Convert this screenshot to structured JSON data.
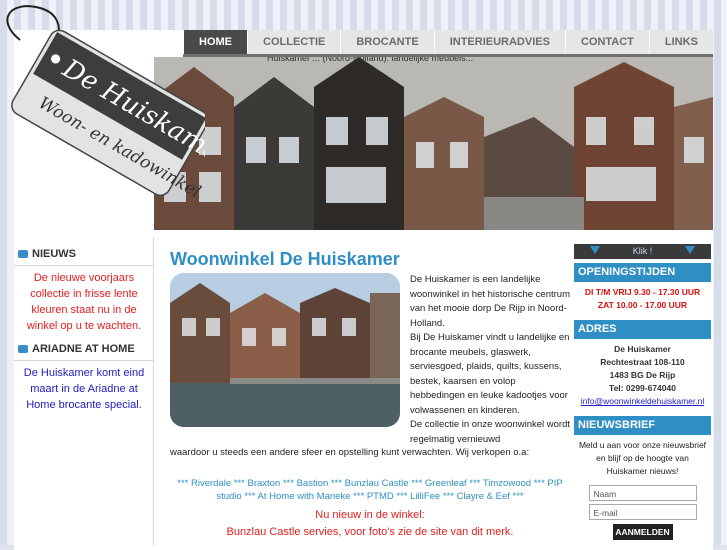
{
  "nav": {
    "items": [
      "HOME",
      "COLLECTIE",
      "BROCANTE",
      "INTERIEURADVIES",
      "CONTACT",
      "LINKS"
    ],
    "active": 0
  },
  "ticker": "Huiskamer ... (Noord-Holland): landelijke meubels...",
  "logo": {
    "title": "De Huiskamer",
    "subtitle": "Woon- en kadowinkel"
  },
  "left": {
    "nieuws_head": "NIEUWS",
    "nieuws_text": "De nieuwe voorjaars collectie in frisse lente kleuren staat nu in de winkel op u te wachten.",
    "ariadne_head": "ARIADNE AT HOME",
    "ariadne_text": "De Huiskamer komt eind maart in de Ariadne at Home brocante special."
  },
  "main": {
    "title": "Woonwinkel De Huiskamer",
    "intro_1": "De Huiskamer is een landelijke woonwinkel in het historische centrum van het mooie dorp De Rijp in Noord-Holland.",
    "intro_2": "Bij De Huiskamer vindt u landelijke en brocante meubels, glaswerk, serviesgoed, plaids, quilts, kussens, bestek, kaarsen en volop hebbedingen en leuke kadootjes voor volwassenen en kinderen.",
    "intro_3a": "De collectie in onze woonwinkel wordt regelmatig vernieuwd",
    "intro_3b": "waardoor u steeds een andere sfeer en opstelling kunt verwachten. Wij verkopen o.a:",
    "brands": "*** Riverdale *** Braxton *** Bastion *** Bunzlau Castle *** Greenleaf *** Timzowood *** PIP studio *** At Home with Marieke *** PTMD *** LilliFee *** Clayre & Eef ***",
    "nieuw_head": "Nu nieuw in de winkel:",
    "nieuw_text": "Bunzlau Castle servies, voor foto's zie de site van dit merk."
  },
  "right": {
    "klik": "Klik !",
    "opening_head": "OPENINGSTIJDEN",
    "opening_1": "DI T/M VRIJ 9.30 - 17.30 UUR",
    "opening_2": "ZAT 10.00 - 17.00 UUR",
    "adres_head": "ADRES",
    "adres_name": "De Huiskamer",
    "adres_street": "Rechtestraat 108-110",
    "adres_city": "1483 BG De Rijp",
    "adres_tel": "Tel: 0299-674040",
    "adres_email": "info@woonwinkeldehuiskamer.nl",
    "news_head": "NIEUWSBRIEF",
    "news_text": "Meld u aan voor onze nieuwsbrief en blijf op de hoogte van Huiskamer nieuws!",
    "name_placeholder": "Naam",
    "email_placeholder": "E-mail",
    "submit": "AANMELDEN"
  }
}
